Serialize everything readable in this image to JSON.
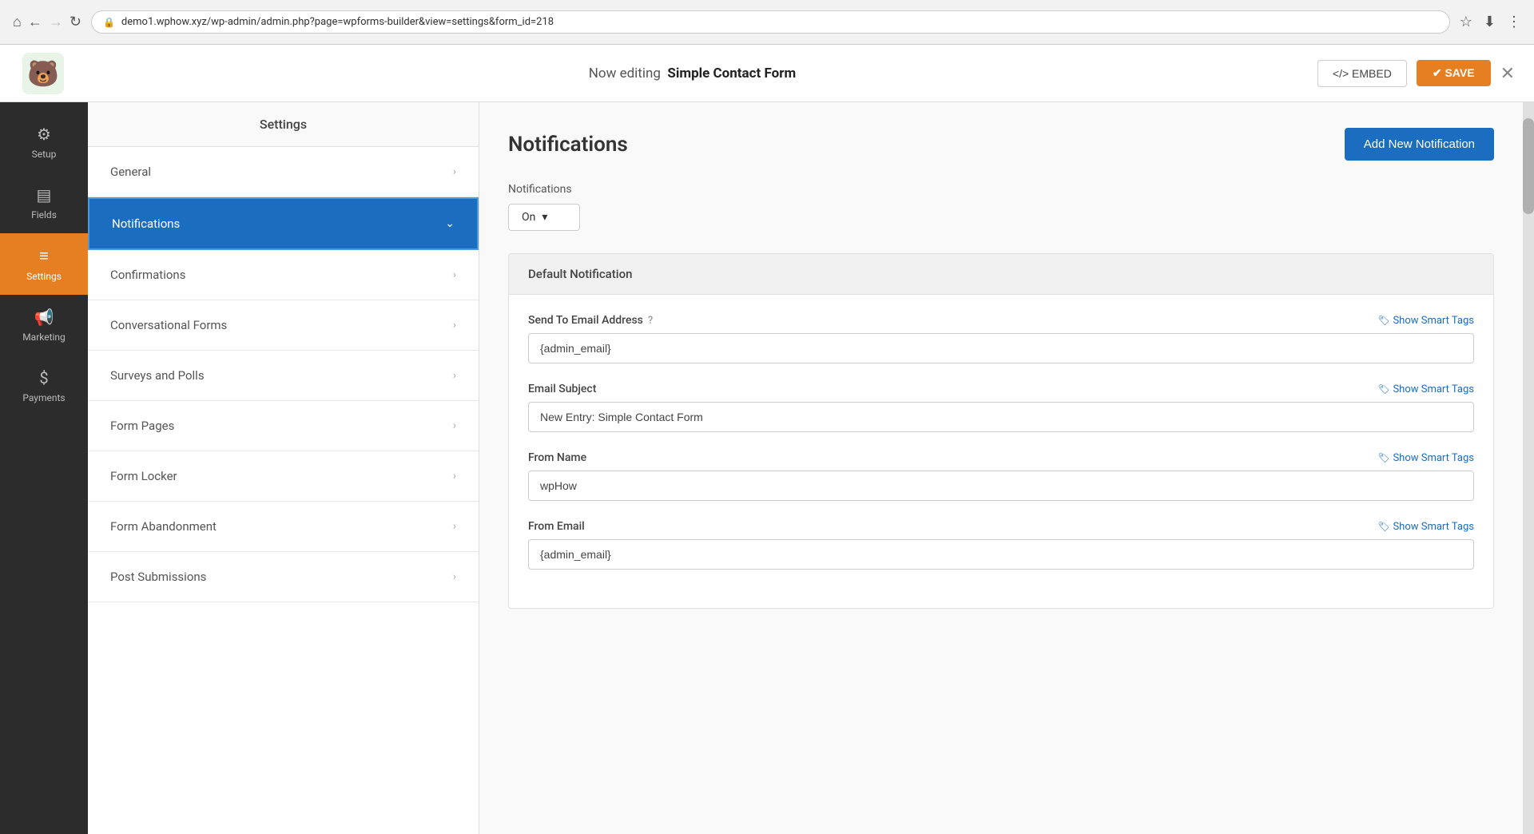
{
  "browser": {
    "url": "demo1.wphow.xyz/wp-admin/admin.php?page=wpforms-builder&view=settings&form_id=218",
    "nav": {
      "home": "⌂",
      "back": "←",
      "forward": "→",
      "reload": "↻"
    }
  },
  "app_header": {
    "editing_label": "Now editing",
    "form_name": "Simple Contact Form",
    "embed_label": "</> EMBED",
    "save_label": "✔ SAVE",
    "close_label": "✕"
  },
  "settings_header": {
    "title": "Settings"
  },
  "icon_sidebar": {
    "items": [
      {
        "id": "setup",
        "icon": "⚙",
        "label": "Setup"
      },
      {
        "id": "fields",
        "icon": "▤",
        "label": "Fields"
      },
      {
        "id": "settings",
        "icon": "≡",
        "label": "Settings",
        "active": true
      },
      {
        "id": "marketing",
        "icon": "📢",
        "label": "Marketing"
      },
      {
        "id": "payments",
        "icon": "$",
        "label": "Payments"
      }
    ]
  },
  "settings_menu": {
    "items": [
      {
        "id": "general",
        "label": "General",
        "active": false
      },
      {
        "id": "notifications",
        "label": "Notifications",
        "active": true
      },
      {
        "id": "confirmations",
        "label": "Confirmations",
        "active": false
      },
      {
        "id": "conversational-forms",
        "label": "Conversational Forms",
        "active": false
      },
      {
        "id": "surveys-polls",
        "label": "Surveys and Polls",
        "active": false
      },
      {
        "id": "form-pages",
        "label": "Form Pages",
        "active": false
      },
      {
        "id": "form-locker",
        "label": "Form Locker",
        "active": false
      },
      {
        "id": "form-abandonment",
        "label": "Form Abandonment",
        "active": false
      },
      {
        "id": "post-submissions",
        "label": "Post Submissions",
        "active": false
      }
    ]
  },
  "main_content": {
    "title": "Notifications",
    "add_notification_btn": "Add New Notification",
    "notifications_label": "Notifications",
    "notifications_value": "On",
    "default_notification": {
      "header": "Default Notification",
      "fields": [
        {
          "id": "send-to-email",
          "label": "Send To Email Address",
          "has_help": true,
          "show_smart_tags": "Show Smart Tags",
          "value": "{admin_email}"
        },
        {
          "id": "email-subject",
          "label": "Email Subject",
          "has_help": false,
          "show_smart_tags": "Show Smart Tags",
          "value": "New Entry: Simple Contact Form"
        },
        {
          "id": "from-name",
          "label": "From Name",
          "has_help": false,
          "show_smart_tags": "Show Smart Tags",
          "value": "wpHow"
        },
        {
          "id": "from-email",
          "label": "From Email",
          "has_help": false,
          "show_smart_tags": "Show Smart Tags",
          "value": "{admin_email}"
        }
      ]
    }
  }
}
